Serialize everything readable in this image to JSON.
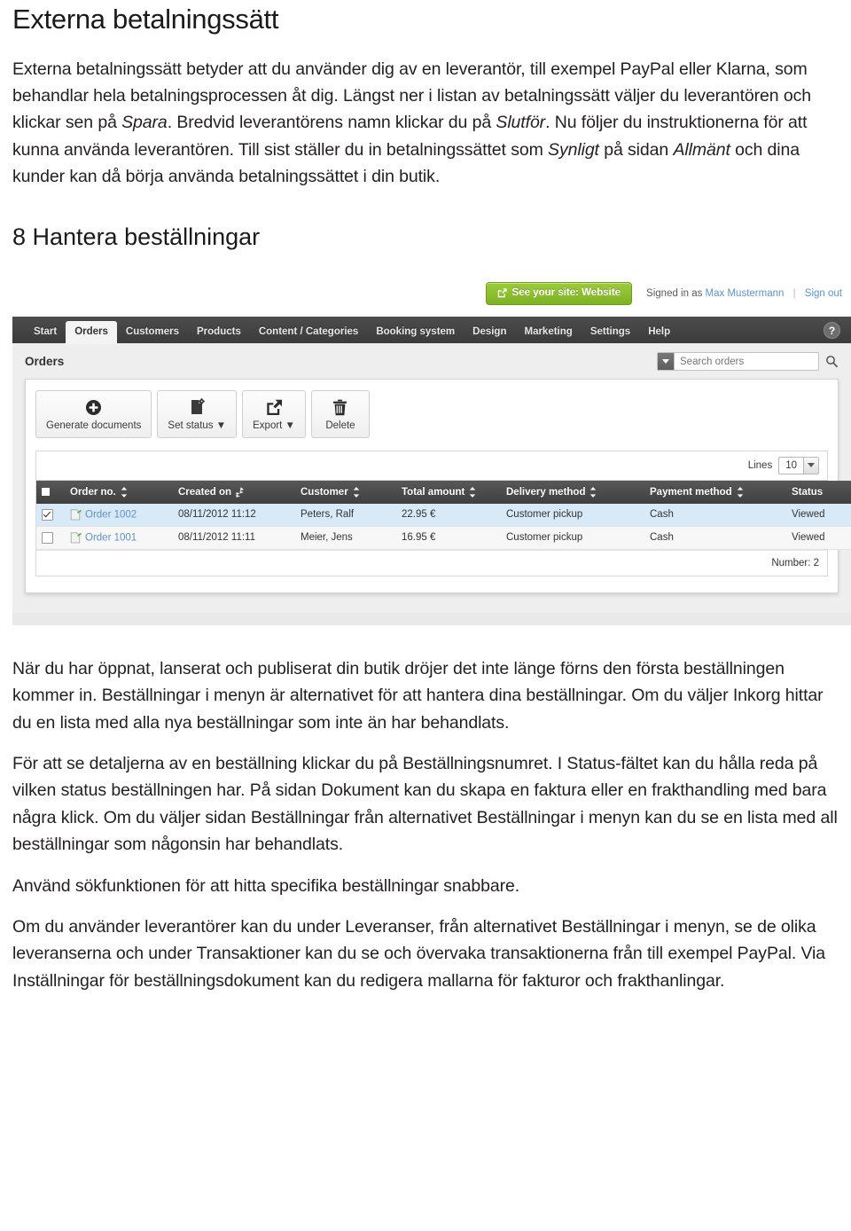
{
  "document": {
    "title": "Externa betalningssätt",
    "intro_paragraph_html": "Externa betalningssätt betyder att du använder dig av en leverantör, till exempel PayPal eller Klarna, som behandlar hela betalningsprocessen åt dig. Längst ner i listan av betalningssätt väljer du leverantören och klickar sen på <em>Spara</em>. Bredvid leverantörens namn klickar du på <em>Slutför</em>. Nu följer du instruktionerna för att kunna använda leverantören. Till sist ställer du in betalningssättet som <em>Synligt</em> på sidan <em>Allmänt</em> och dina kunder kan då börja använda betalningssättet i din butik.",
    "section_heading": "8 Hantera beställningar",
    "paragraphs_after": [
      "När du har öppnat, lanserat och publiserat din butik dröjer det inte länge förns den första beställningen kommer in. Beställningar i menyn är alternativet för att hantera dina beställningar. Om du väljer Inkorg hittar du en lista med alla nya beställningar som inte än har behandlats.",
      "För att se detaljerna av en beställning klickar du på Beställningsnumret. I Status-fältet kan du hålla reda på vilken status beställningen har. På sidan Dokument kan du skapa en faktura eller en frakthandling med bara några klick. Om du väljer sidan Beställningar från alternativet Beställningar i menyn kan du se en lista med all beställningar som någonsin har behandlats.",
      "Använd sökfunktionen för att hitta specifika beställningar snabbare.",
      "Om du använder leverantörer kan du under Leveranser, från alternativet Beställningar i menyn, se de olika leveranserna och under Transaktioner kan du se och övervaka transaktionerna från till exempel PayPal. Via Inställningar för beställningsdokument kan du redigera mallarna för fakturor och frakthanlingar."
    ]
  },
  "app": {
    "topbar": {
      "see_site_label": "See your site: Website",
      "signed_in_prefix": "Signed in as",
      "user_name": "Max Mustermann",
      "sign_out_label": "Sign out",
      "accent_green": "#8cc231"
    },
    "nav": {
      "items": [
        {
          "label": "Start",
          "active": false
        },
        {
          "label": "Orders",
          "active": true
        },
        {
          "label": "Customers",
          "active": false
        },
        {
          "label": "Products",
          "active": false
        },
        {
          "label": "Content / Categories",
          "active": false
        },
        {
          "label": "Booking system",
          "active": false
        },
        {
          "label": "Design",
          "active": false
        },
        {
          "label": "Marketing",
          "active": false
        },
        {
          "label": "Settings",
          "active": false
        },
        {
          "label": "Help",
          "active": false
        }
      ],
      "help_glyph": "?"
    },
    "page": {
      "subheading": "Orders",
      "search_placeholder": "Search orders"
    },
    "toolbar": [
      {
        "label": "Generate documents",
        "icon": "plus-circle-icon",
        "has_caret": false
      },
      {
        "label": "Set status",
        "icon": "document-gear-icon",
        "has_caret": true
      },
      {
        "label": "Export",
        "icon": "export-arrow-icon",
        "has_caret": true
      },
      {
        "label": "Delete",
        "icon": "trash-icon",
        "has_caret": false
      }
    ],
    "grid": {
      "lines_label": "Lines",
      "lines_value": "10",
      "columns": [
        {
          "label": "",
          "sortable": false,
          "key": "check"
        },
        {
          "label": "Order no.",
          "sortable": true,
          "key": "order"
        },
        {
          "label": "Created on",
          "sortable": true,
          "key": "created"
        },
        {
          "label": "Customer",
          "sortable": true,
          "key": "customer"
        },
        {
          "label": "Total amount",
          "sortable": true,
          "key": "total"
        },
        {
          "label": "Delivery method",
          "sortable": true,
          "key": "delivery"
        },
        {
          "label": "Payment method",
          "sortable": true,
          "key": "payment"
        },
        {
          "label": "Status",
          "sortable": false,
          "key": "status"
        }
      ],
      "rows": [
        {
          "checked": true,
          "order": "Order 1002",
          "created": "08/11/2012 11:12",
          "customer": "Peters, Ralf",
          "total": "22.95 €",
          "delivery": "Customer pickup",
          "payment": "Cash",
          "status": "Viewed"
        },
        {
          "checked": false,
          "order": "Order 1001",
          "created": "08/11/2012 11:11",
          "customer": "Meier, Jens",
          "total": "16.95 €",
          "delivery": "Customer pickup",
          "payment": "Cash",
          "status": "Viewed"
        }
      ],
      "footer_label": "Number: 2"
    }
  }
}
